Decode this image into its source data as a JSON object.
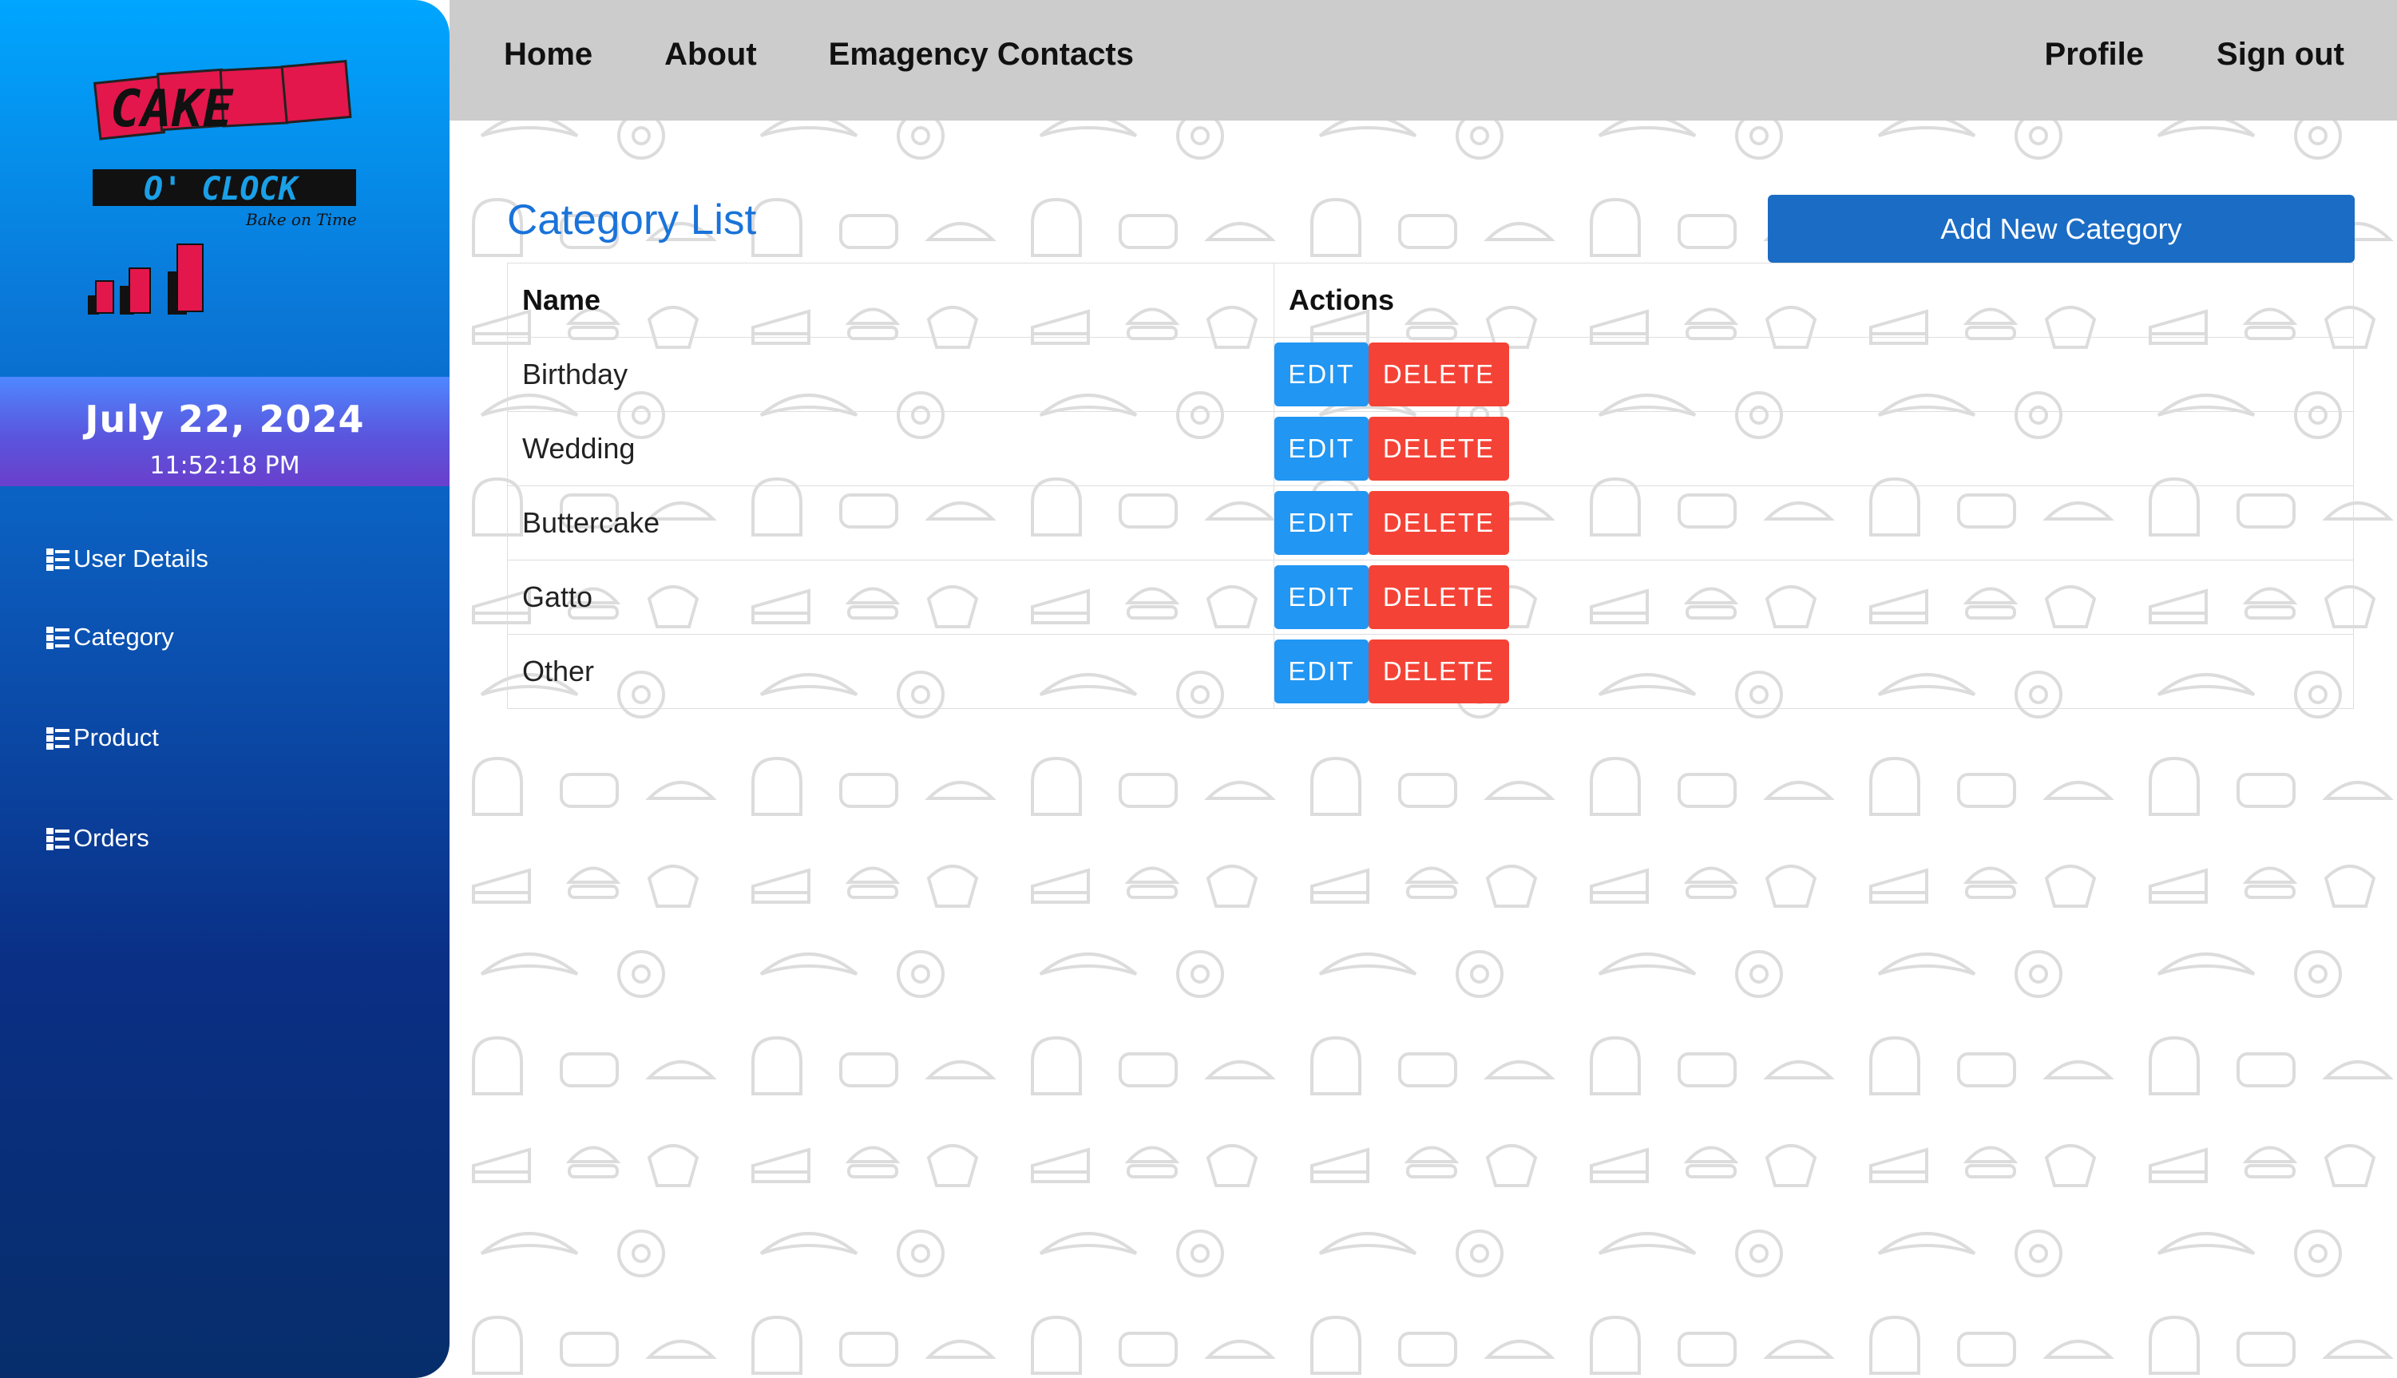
{
  "brand": {
    "logo_word": "CAKE",
    "logo_sub": "O' CLOCK",
    "logo_tagline": "Bake on Time"
  },
  "sidebar": {
    "date": "July 22, 2024",
    "time": "11:52:18 PM",
    "items": [
      {
        "label": "User Details",
        "icon": "list-icon"
      },
      {
        "label": "Category",
        "icon": "list-icon"
      },
      {
        "label": "Product",
        "icon": "list-icon"
      },
      {
        "label": "Orders",
        "icon": "list-icon"
      }
    ]
  },
  "nav": {
    "left": [
      "Home",
      "About",
      "Emagency Contacts"
    ],
    "right": [
      "Profile",
      "Sign out"
    ]
  },
  "main": {
    "title": "Category List",
    "add_button": "Add New Category",
    "table": {
      "headers": [
        "Name",
        "Actions"
      ],
      "rows": [
        "Birthday",
        "Wedding",
        "Buttercake",
        "Gatto",
        "Other"
      ],
      "edit_label": "EDIT",
      "delete_label": "DELETE"
    }
  },
  "colors": {
    "accent": "#1a73d9",
    "edit": "#2196f3",
    "delete": "#f44336",
    "nav_bg": "#cccccc"
  }
}
